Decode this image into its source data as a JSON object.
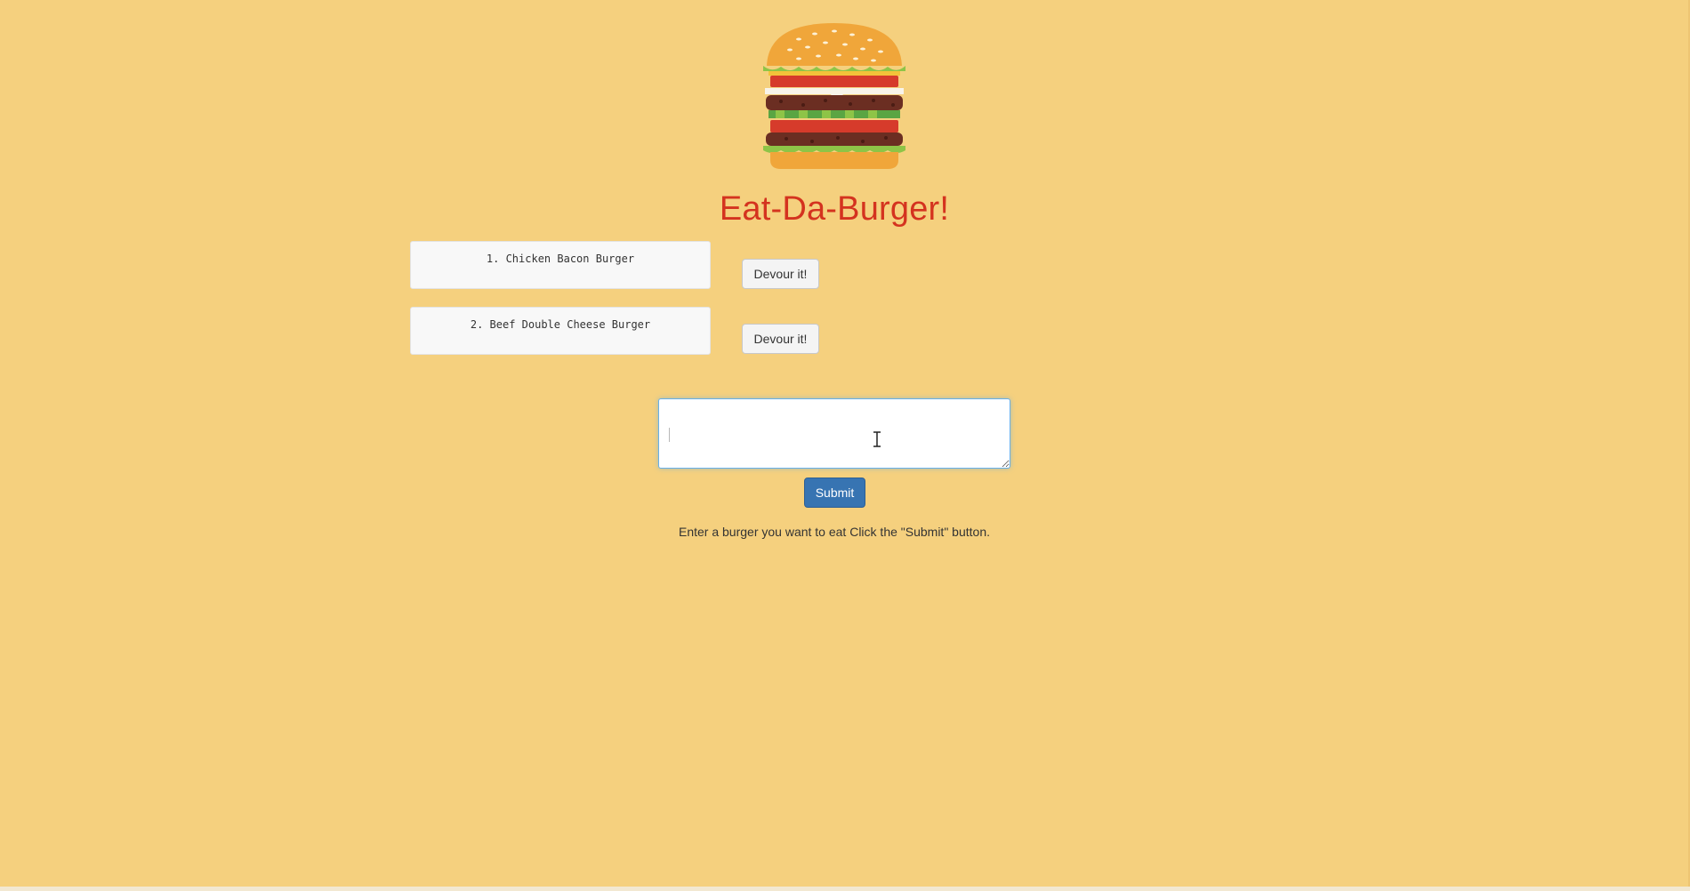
{
  "header": {
    "logo_icon": "burger-icon",
    "title": "Eat-Da-Burger!"
  },
  "burgers": [
    {
      "label": "1. Chicken Bacon Burger",
      "button_label": "Devour it!"
    },
    {
      "label": "2. Beef Double Cheese Burger",
      "button_label": "Devour it!"
    }
  ],
  "form": {
    "input_value": "",
    "input_placeholder": "",
    "submit_label": "Submit",
    "instructions": "Enter a burger you want to eat Click the \"Submit\" button."
  },
  "colors": {
    "background": "#f5d07e",
    "title": "#d4331f",
    "submit": "#3774b2"
  }
}
